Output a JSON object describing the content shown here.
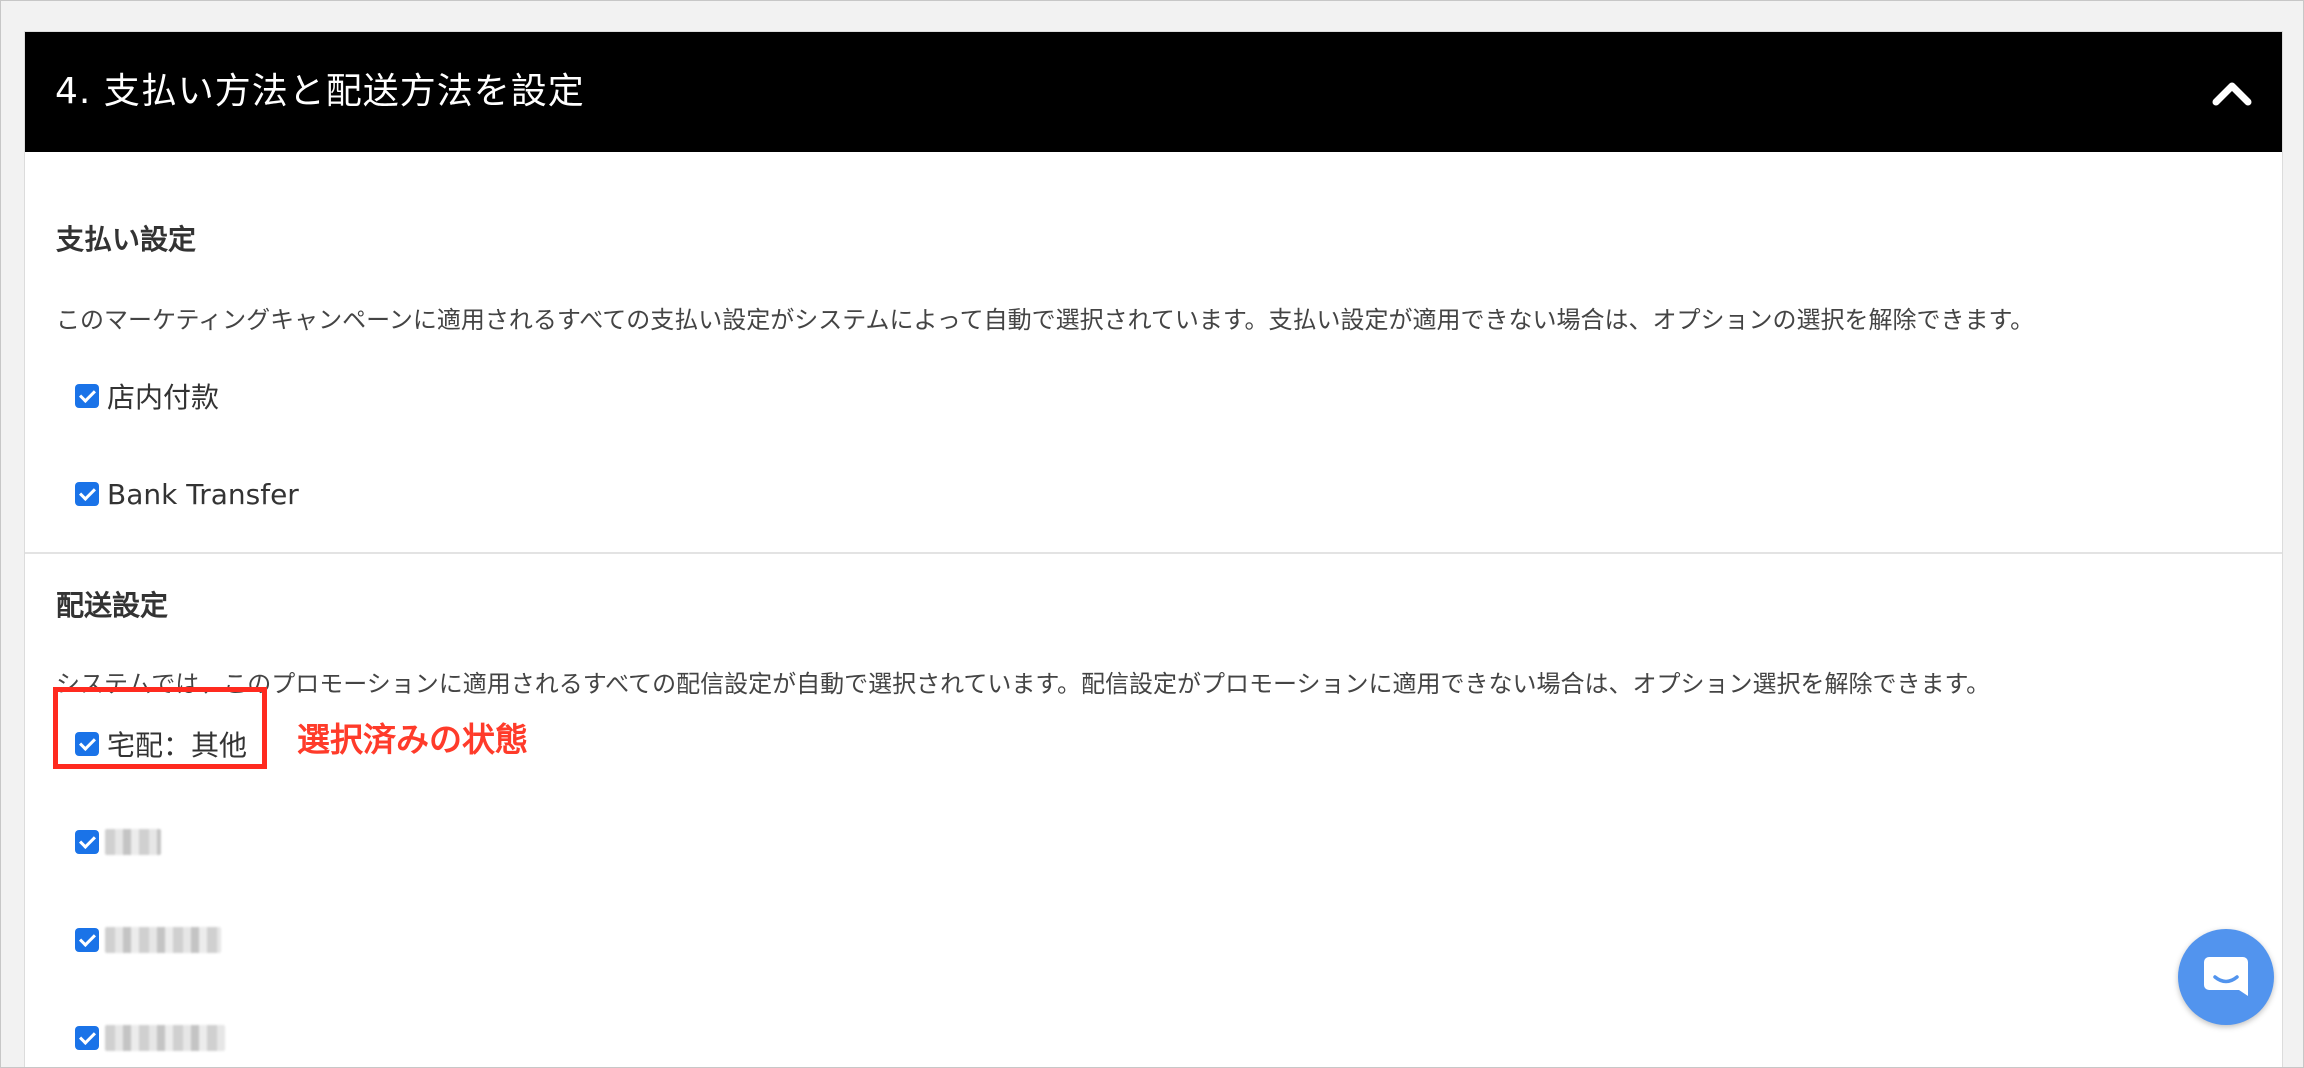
{
  "section": {
    "title": "4. 支払い方法と配送方法を設定"
  },
  "payment": {
    "title": "支払い設定",
    "description": "このマーケティングキャンペーンに適用されるすべての支払い設定がシステムによって自動で選択されています。支払い設定が適用できない場合は、オプションの選択を解除できます。",
    "options": [
      {
        "label": "店内付款",
        "checked": true
      },
      {
        "label": "Bank Transfer",
        "checked": true
      }
    ]
  },
  "shipping": {
    "title": "配送設定",
    "description": "システムでは、このプロモーションに適用されるすべての配信設定が自動で選択されています。配信設定がプロモーションに適用できない場合は、オプション選択を解除できます。",
    "options": [
      {
        "label": "宅配：其他",
        "checked": true
      },
      {
        "label": "",
        "checked": true,
        "blurred": true
      },
      {
        "label": "",
        "checked": true,
        "blurred": true
      },
      {
        "label": "",
        "checked": true,
        "blurred": true
      }
    ]
  },
  "annotation": {
    "text": "選択済みの状態",
    "color": "#ff3b2a"
  },
  "colors": {
    "header_bg": "#000000",
    "checkbox": "#1a73e8",
    "chat_bubble": "#5294ee"
  },
  "icons": {
    "collapse": "chevron-up-icon",
    "chat": "chat-icon"
  }
}
